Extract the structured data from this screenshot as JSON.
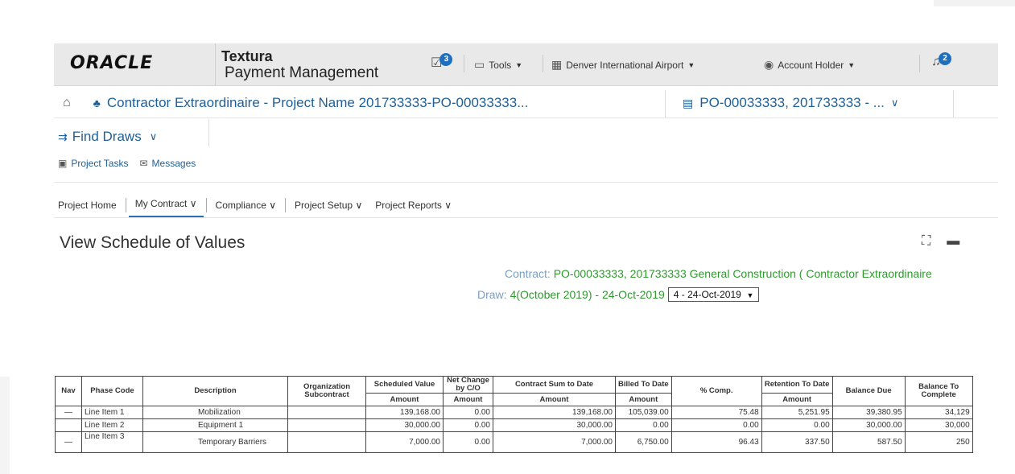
{
  "header": {
    "logo": "ORACLE",
    "product_line1": "Textura",
    "product_line2": "Payment Management",
    "inbox_badge": "3",
    "tools_label": "Tools",
    "org_label": "Denver International Airport",
    "account_label": "Account Holder",
    "notify_badge": "2"
  },
  "breadcrumb": {
    "project": "Contractor Extraordinaire  - Project Name 201733333-PO-00033333...",
    "po": "PO-00033333, 201733333 - ..."
  },
  "find_draws": "Find Draws",
  "sublinks": {
    "tasks": "Project Tasks",
    "messages": "Messages"
  },
  "tabs": [
    "Project Home",
    "My Contract",
    "Compliance",
    "Project Setup",
    "Project Reports"
  ],
  "page_title": "View Schedule of Values",
  "contract": {
    "label": "Contract: ",
    "value": "PO-00033333, 201733333 General Construction ( Contractor Extraordinaire"
  },
  "draw": {
    "label": "Draw: ",
    "value": "4(October 2019) - 24-Oct-2019",
    "select": "4 - 24-Oct-2019"
  },
  "table": {
    "headers": {
      "nav": "Nav",
      "phase_code": "Phase Code",
      "description": "Description",
      "org": "Organization Subcontract",
      "scheduled": "Scheduled Value",
      "net_change": "Net Change by C/O",
      "contract_sum": "Contract Sum to Date",
      "billed": "Billed To Date",
      "pct": "% Comp.",
      "retention": "Retention To Date",
      "balance_due": "Balance Due",
      "balance_complete": "Balance To Complete",
      "amount": "Amount"
    },
    "rows": [
      {
        "nav": "—",
        "phase": "Line Item 1",
        "desc": "Mobilization",
        "sched": "139,168.00",
        "net": "0.00",
        "sum": "139,168.00",
        "billed": "105,039.00",
        "pct": "75.48",
        "ret": "5,251.95",
        "due": "39,380.95",
        "complete": "34,129"
      },
      {
        "nav": "",
        "phase": "Line Item 2",
        "desc": "Equipment 1",
        "sched": "30,000.00",
        "net": "0.00",
        "sum": "30,000.00",
        "billed": "0.00",
        "pct": "0.00",
        "ret": "0.00",
        "due": "30,000.00",
        "complete": "30,000"
      },
      {
        "nav": "—",
        "phase": "Line Item 3",
        "desc": "Temporary Barriers",
        "sched": "7,000.00",
        "net": "0.00",
        "sum": "7,000.00",
        "billed": "6,750.00",
        "pct": "96.43",
        "ret": "337.50",
        "due": "587.50",
        "complete": "250"
      }
    ]
  },
  "colors": {
    "link": "#1f5f98",
    "badge": "#1d6fbf",
    "green": "#2e9a2e",
    "label": "#7a9ec2"
  }
}
